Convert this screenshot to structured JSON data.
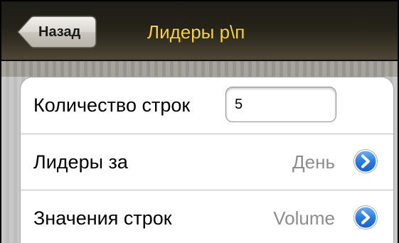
{
  "navbar": {
    "back_label": "Назад",
    "title": "Лидеры р\\п",
    "title_color": "#f7d43a"
  },
  "rows": [
    {
      "label": "Количество строк",
      "field_value": "5"
    },
    {
      "label": "Лидеры за",
      "value": "День",
      "icon": "chevron-right-circle-icon"
    },
    {
      "label": "Значения строк",
      "value": "Volume",
      "icon": "chevron-right-circle-icon"
    }
  ],
  "colors": {
    "accent_blue": "#2a7de1",
    "detail_text": "#8d8d8d"
  }
}
